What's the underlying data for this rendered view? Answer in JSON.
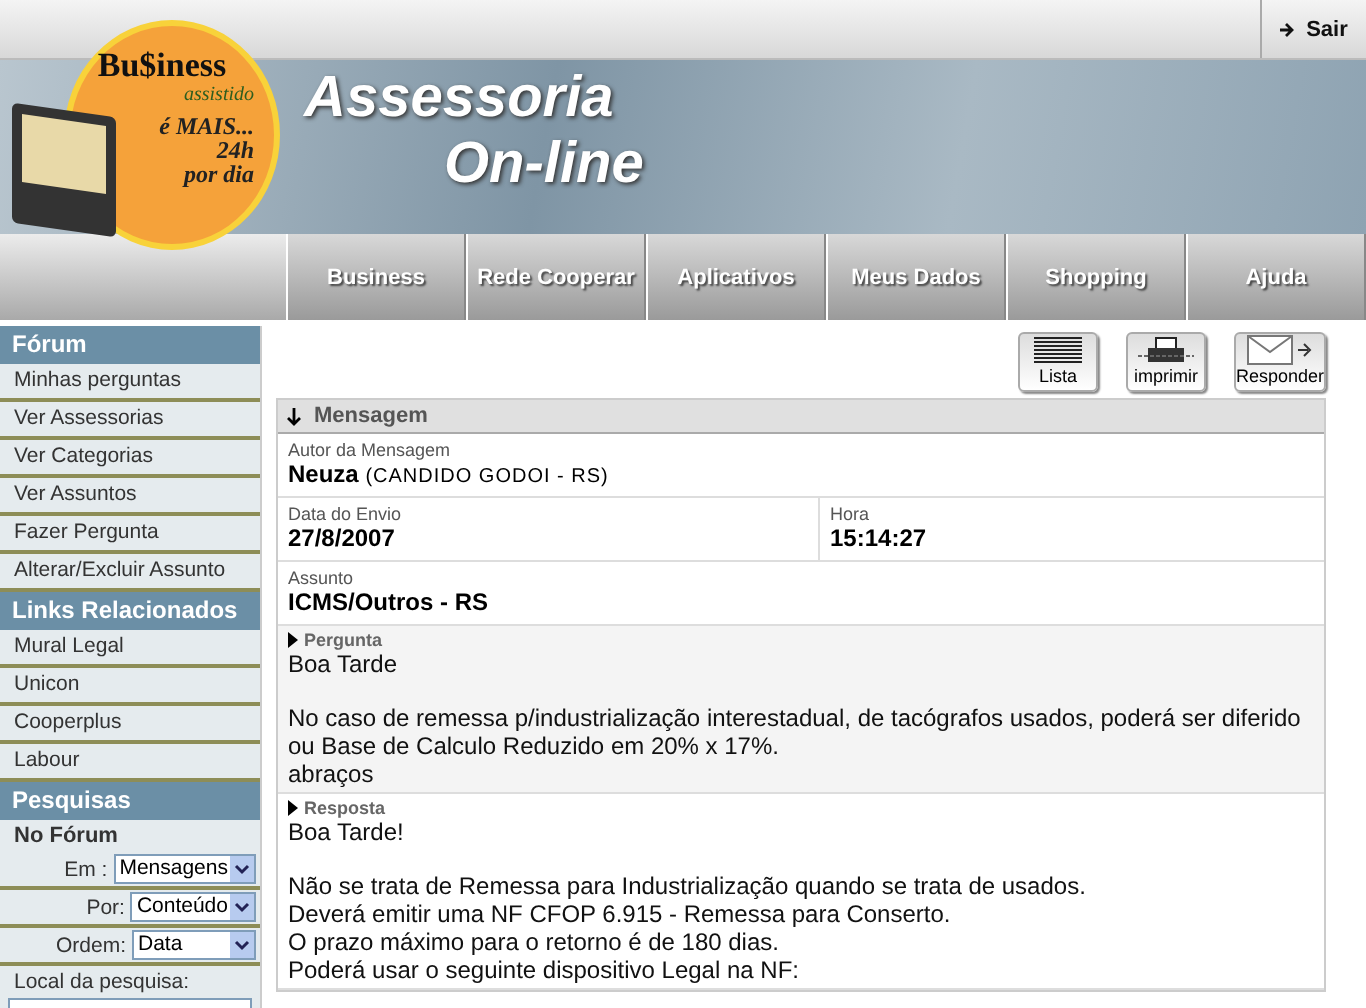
{
  "top_bar": {
    "logout": "Sair"
  },
  "logo": {
    "brand": "Bu$iness",
    "tagline": "assistido",
    "slogan": [
      "é MAIS...",
      "24h",
      "por dia"
    ]
  },
  "banner": {
    "title_line_1": "Assessoria",
    "title_line_2": "On-line"
  },
  "nav": [
    {
      "label": "Business"
    },
    {
      "label": "Rede Cooperar"
    },
    {
      "label": "Aplicativos"
    },
    {
      "label": "Meus Dados"
    },
    {
      "label": "Shopping"
    },
    {
      "label": "Ajuda"
    }
  ],
  "sidebar": {
    "sections": [
      {
        "title": "Fórum",
        "items": [
          "Minhas perguntas",
          "Ver Assessorias",
          "Ver Categorias",
          "Ver Assuntos",
          "Fazer Pergunta",
          "Alterar/Excluir Assunto"
        ]
      },
      {
        "title": "Links Relacionados",
        "items": [
          "Mural Legal",
          "Unicon",
          "Cooperplus",
          "Labour"
        ]
      }
    ],
    "search": {
      "title": "Pesquisas",
      "subtitle": "No Fórum",
      "filters": [
        {
          "label": "Em :",
          "value": "Mensagens"
        },
        {
          "label": "Por:",
          "value": "Conteúdo"
        },
        {
          "label": "Ordem:",
          "value": "Data"
        }
      ],
      "location_label": "Local da pesquisa:"
    }
  },
  "toolbar": [
    {
      "kind": "list",
      "label": "Lista"
    },
    {
      "kind": "printer",
      "label": "imprimir"
    },
    {
      "kind": "envelope",
      "label": "Responder"
    }
  ],
  "message": {
    "title": "Mensagem",
    "author_label": "Autor da Mensagem",
    "author_name": "Neuza",
    "author_location": "(CANDIDO GODOI - RS)",
    "date_label": "Data do Envio",
    "date": "27/8/2007",
    "time_label": "Hora",
    "time": "15:14:27",
    "subject_label": "Assunto",
    "subject": "ICMS/Outros - RS",
    "posts": [
      {
        "kind": "question",
        "label": "Pergunta",
        "paragraphs": [
          [
            "Boa Tarde"
          ],
          [
            "No caso de remessa p/industrialização interestadual, de tacógrafos usados, poderá ser diferido ou Base de Calculo Reduzido em 20% x 17%.",
            "abraços"
          ]
        ]
      },
      {
        "kind": "answer",
        "label": "Resposta",
        "paragraphs": [
          [
            "Boa Tarde!"
          ],
          [
            "Não se trata de Remessa para Industrialização quando se trata de usados.",
            "Deverá emitir uma NF CFOP 6.915 - Remessa para Conserto.",
            "O prazo máximo para o retorno é de 180 dias.",
            "Poderá usar o seguinte dispositivo Legal na NF:"
          ]
        ]
      }
    ]
  }
}
